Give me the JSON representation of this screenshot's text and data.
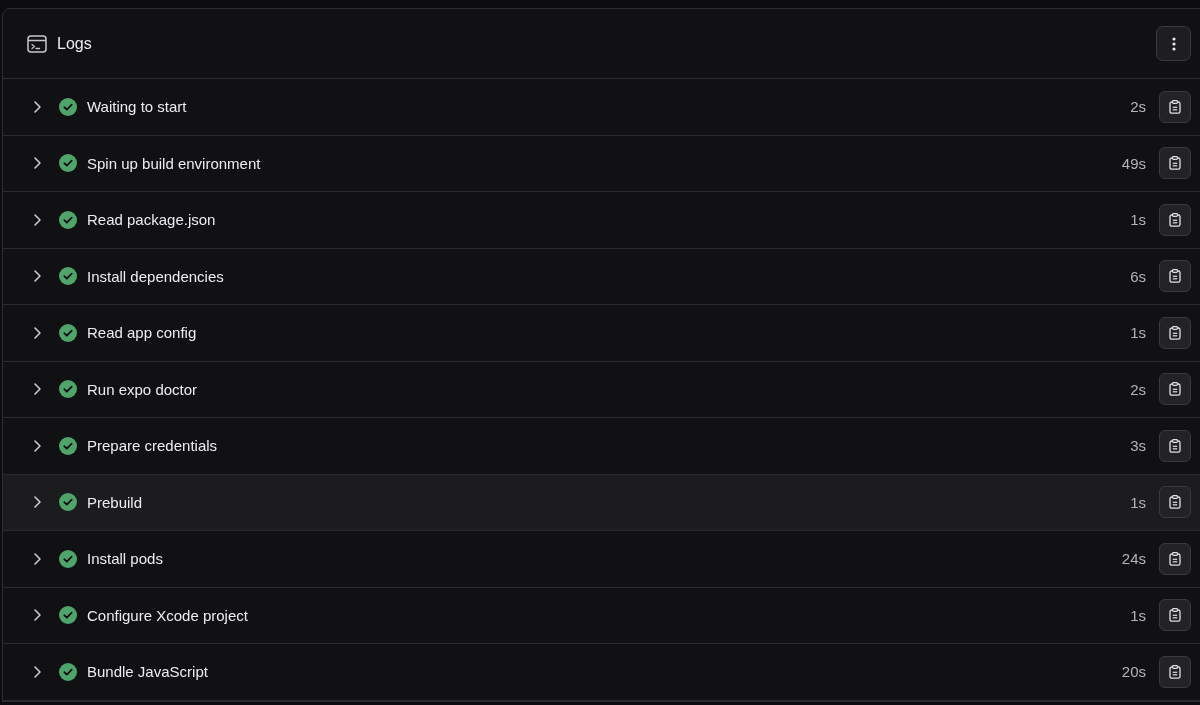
{
  "panel": {
    "title": "Logs"
  },
  "steps": [
    {
      "name": "Waiting to start",
      "done": true,
      "duration": "2s",
      "expanded": false,
      "highlighted": false
    },
    {
      "name": "Spin up build environment",
      "done": true,
      "duration": "49s",
      "expanded": false,
      "highlighted": false
    },
    {
      "name": "Read package.json",
      "done": true,
      "duration": "1s",
      "expanded": false,
      "highlighted": false
    },
    {
      "name": "Install dependencies",
      "done": true,
      "duration": "6s",
      "expanded": false,
      "highlighted": false
    },
    {
      "name": "Read app config",
      "done": true,
      "duration": "1s",
      "expanded": false,
      "highlighted": false
    },
    {
      "name": "Run expo doctor",
      "done": true,
      "duration": "2s",
      "expanded": false,
      "highlighted": false
    },
    {
      "name": "Prepare credentials",
      "done": true,
      "duration": "3s",
      "expanded": false,
      "highlighted": false
    },
    {
      "name": "Prebuild",
      "done": true,
      "duration": "1s",
      "expanded": false,
      "highlighted": true
    },
    {
      "name": "Install pods",
      "done": true,
      "duration": "24s",
      "expanded": false,
      "highlighted": false
    },
    {
      "name": "Configure Xcode project",
      "done": true,
      "duration": "1s",
      "expanded": false,
      "highlighted": false
    },
    {
      "name": "Bundle JavaScript",
      "done": true,
      "duration": "20s",
      "expanded": false,
      "highlighted": false
    }
  ]
}
